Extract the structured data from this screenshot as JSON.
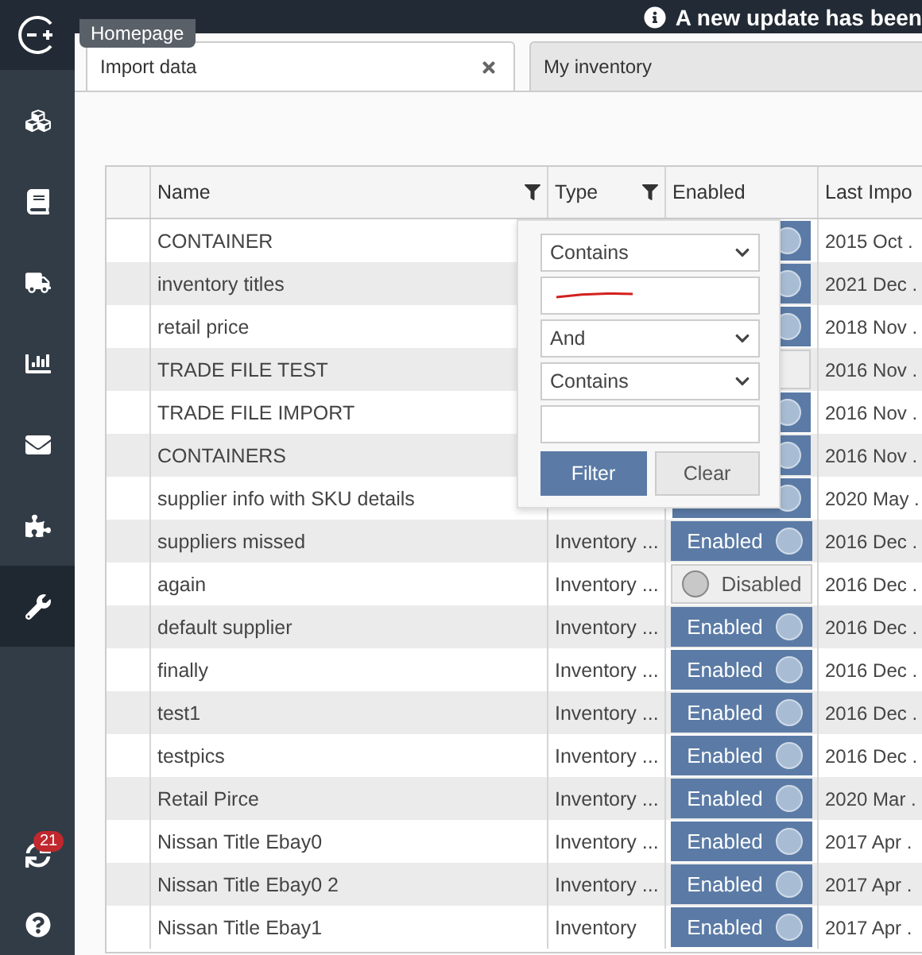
{
  "top_bar": {
    "notice": "A new update has been"
  },
  "tooltip": "Homepage",
  "sidebar": {
    "items": [
      {
        "kind": "cubes",
        "selected": false
      },
      {
        "kind": "book",
        "selected": false
      },
      {
        "kind": "truck",
        "selected": false
      },
      {
        "kind": "chart",
        "selected": false
      },
      {
        "kind": "mail",
        "selected": false
      },
      {
        "kind": "puzzle",
        "selected": false
      },
      {
        "kind": "wrench",
        "selected": true
      }
    ],
    "sync_badge": "21"
  },
  "tabs": [
    {
      "label": "Import data",
      "selected": true,
      "closable": true
    },
    {
      "label": "My inventory",
      "selected": false,
      "closable": false
    }
  ],
  "table": {
    "columns": [
      {
        "label": "Name",
        "filter": true
      },
      {
        "label": "Type",
        "filter": true
      },
      {
        "label": "Enabled",
        "filter": false
      },
      {
        "label": "Last Impo"
      }
    ],
    "rows": [
      {
        "name": "CONTAINER",
        "enabled": true,
        "last": "2015 Oct ."
      },
      {
        "name": "inventory titles",
        "enabled": true,
        "last": "2021 Dec ."
      },
      {
        "name": "retail price",
        "enabled": true,
        "last": "2018 Nov ."
      },
      {
        "name": "TRADE FILE TEST",
        "enabled": false,
        "last": "2016 Nov ."
      },
      {
        "name": "TRADE FILE IMPORT",
        "enabled": true,
        "last": "2016 Nov ."
      },
      {
        "name": "CONTAINERS",
        "enabled": true,
        "last": "2016 Nov ."
      },
      {
        "name": "supplier info with SKU details",
        "enabled": true,
        "last": "2020 May ."
      },
      {
        "name": "suppliers missed",
        "type": "Inventory ...",
        "status": "Enabled",
        "enabled": true,
        "last": "2016 Dec ."
      },
      {
        "name": "again",
        "type": "Inventory ...",
        "status": "Disabled",
        "enabled": false,
        "last": "2016 Dec ."
      },
      {
        "name": "default supplier",
        "type": "Inventory ...",
        "status": "Enabled",
        "enabled": true,
        "last": "2016 Dec ."
      },
      {
        "name": "finally",
        "type": "Inventory ...",
        "status": "Enabled",
        "enabled": true,
        "last": "2016 Dec ."
      },
      {
        "name": "test1",
        "type": "Inventory ...",
        "status": "Enabled",
        "enabled": true,
        "last": "2016 Dec ."
      },
      {
        "name": "testpics",
        "type": "Inventory ...",
        "status": "Enabled",
        "enabled": true,
        "last": "2016 Dec ."
      },
      {
        "name": "Retail Pirce",
        "type": "Inventory ...",
        "status": "Enabled",
        "enabled": true,
        "last": "2020 Mar ."
      },
      {
        "name": "Nissan Title Ebay0",
        "type": "Inventory ...",
        "status": "Enabled",
        "enabled": true,
        "last": "2017 Apr ."
      },
      {
        "name": "Nissan Title Ebay0 2",
        "type": "Inventory ...",
        "status": "Enabled",
        "enabled": true,
        "last": "2017 Apr ."
      },
      {
        "name": "Nissan Title Ebay1",
        "type": "Inventory",
        "status": "Enabled",
        "enabled": true,
        "last": "2017 Apr ."
      }
    ]
  },
  "filter_popup": {
    "operator_1": "Contains",
    "value_1_redacted": true,
    "logic": "And",
    "operator_2": "Contains",
    "buttons": [
      {
        "label": "Filter",
        "kind": "primary"
      },
      {
        "label": "Clear",
        "kind": "secondary"
      }
    ]
  }
}
